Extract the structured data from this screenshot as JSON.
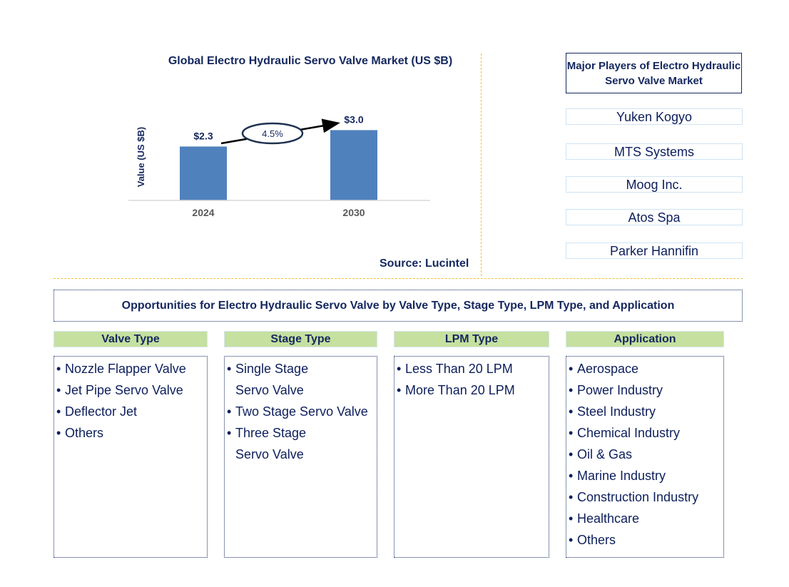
{
  "chart_data": {
    "type": "bar",
    "title": "Global Electro Hydraulic Servo Valve Market (US $B)",
    "xlabel": "",
    "ylabel": "Value (US $B)",
    "categories": [
      "2024",
      "2030"
    ],
    "values": [
      2.3,
      3.0
    ],
    "data_labels": [
      "$2.3",
      "$3.0"
    ],
    "ylim": [
      0,
      3.5
    ],
    "grid": false,
    "annotation": {
      "type": "cagr-arrow",
      "label": "4.5%"
    },
    "bar_color": "#4f81bd",
    "source": "Source: Lucintel"
  },
  "players": {
    "title": "Major Players of Electro Hydraulic Servo Valve Market",
    "items": [
      "Yuken Kogyo",
      "MTS Systems",
      "Moog Inc.",
      "Atos Spa",
      "Parker Hannifin"
    ]
  },
  "opportunities": {
    "title": "Opportunities for Electro Hydraulic Servo Valve by Valve Type, Stage Type, LPM Type, and Application",
    "categories": [
      {
        "label": "Valve Type",
        "items": [
          [
            "Nozzle Flapper Valve"
          ],
          [
            "Jet Pipe Servo Valve"
          ],
          [
            "Deflector Jet"
          ],
          [
            "Others"
          ]
        ]
      },
      {
        "label": "Stage Type",
        "items": [
          [
            "Single Stage",
            "Servo Valve"
          ],
          [
            "Two Stage Servo Valve"
          ],
          [
            "Three Stage",
            "Servo Valve"
          ]
        ]
      },
      {
        "label": "LPM Type",
        "items": [
          [
            "Less Than 20 LPM"
          ],
          [
            "More Than 20 LPM"
          ]
        ]
      },
      {
        "label": "Application",
        "items": [
          [
            "Aerospace"
          ],
          [
            "Power Industry"
          ],
          [
            "Steel Industry"
          ],
          [
            "Chemical Industry"
          ],
          [
            "Oil & Gas"
          ],
          [
            "Marine Industry"
          ],
          [
            "Construction Industry"
          ],
          [
            "Healthcare"
          ],
          [
            "Others"
          ]
        ]
      }
    ]
  },
  "colors": {
    "text_navy": "#14275e",
    "bar": "#4f81bd",
    "header_green": "#c6e0a0",
    "divider_gold": "#f0c030"
  }
}
